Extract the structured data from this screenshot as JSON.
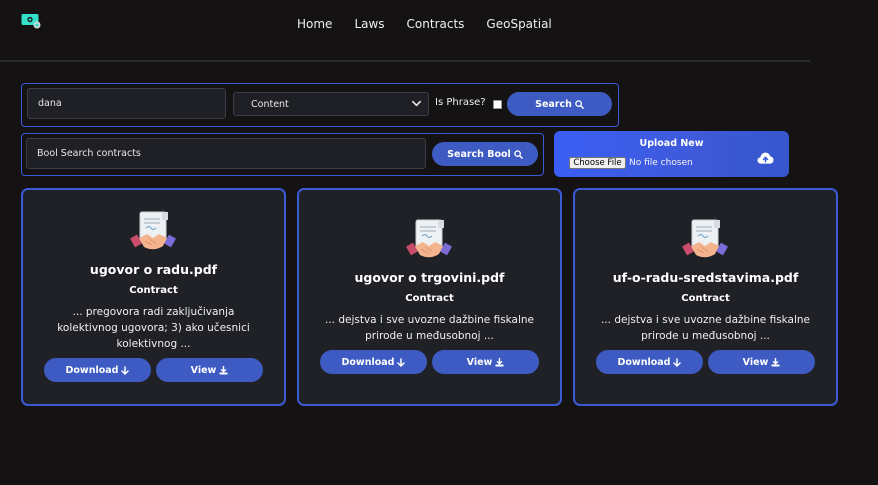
{
  "nav": {
    "logo_icon": "money-bill-icon",
    "items": [
      "Home",
      "Laws",
      "Contracts",
      "GeoSpatial"
    ]
  },
  "search": {
    "query_value": "dana",
    "field_selected": "Content",
    "is_phrase_label": "Is Phrase?",
    "is_phrase_checked": false,
    "search_button": "Search",
    "bool_placeholder": "Bool Search contracts",
    "bool_button": "Search Bool"
  },
  "upload": {
    "title": "Upload New",
    "choose_label": "Choose File",
    "no_file_text": "No file chosen",
    "icon": "cloud-upload-icon"
  },
  "results": [
    {
      "title": "ugovor o radu.pdf",
      "type": "Contract",
      "snippet": "... pregovora radi zaključivanja kolektivnog ugovora; 3) ako učesnici kolektivnog ...",
      "download_label": "Download",
      "view_label": "View"
    },
    {
      "title": "ugovor o trgovini.pdf",
      "type": "Contract",
      "snippet": "... dejstva i sve uvozne dažbine fiskalne prirode u međusobnoj ...",
      "download_label": "Download",
      "view_label": "View"
    },
    {
      "title": "uf-o-radu-sredstavima.pdf",
      "type": "Contract",
      "snippet": "... dejstva i sve uvozne dažbine fiskalne prirode u međusobnoj ...",
      "download_label": "Download",
      "view_label": "View"
    }
  ],
  "colors": {
    "background": "#141212",
    "accent": "#3d5bc2",
    "border": "#3b5bd6",
    "card": "#1f2126"
  }
}
